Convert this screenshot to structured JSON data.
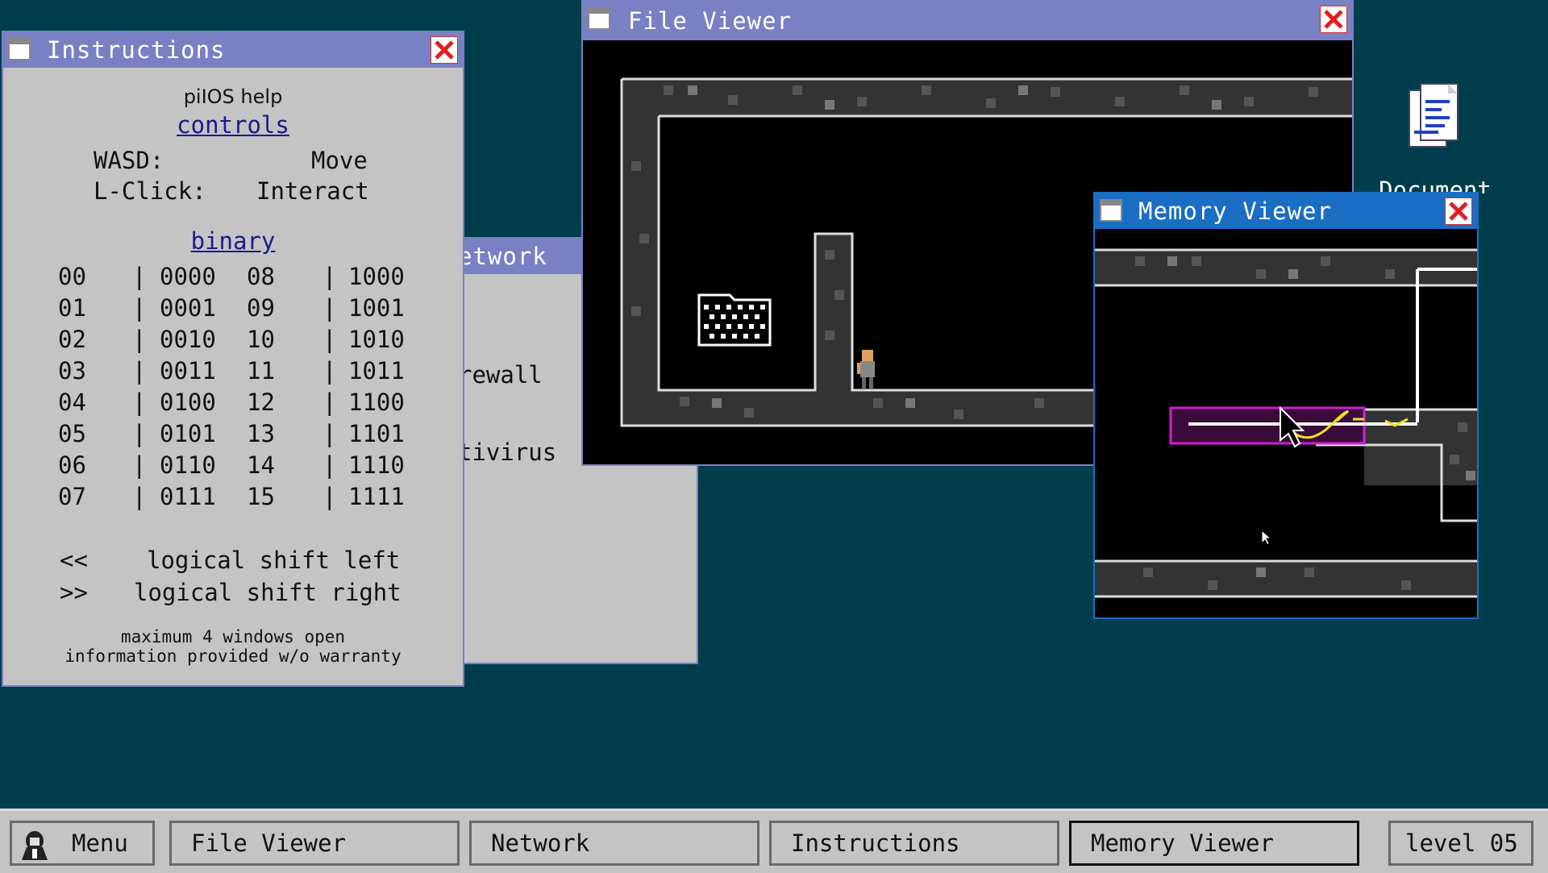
{
  "desktop": {
    "document_icon_label": "Document"
  },
  "windows": {
    "network": {
      "title": "Network",
      "items": [
        "Firewall",
        "Antivirus"
      ],
      "visible_items": [
        "rewall",
        "tivirus"
      ],
      "visible_title": "etwork"
    },
    "instructions": {
      "title": "Instructions",
      "heading": "piIOS help",
      "controls_header": "controls",
      "controls": [
        {
          "key": "WASD:",
          "action": "Move"
        },
        {
          "key": "L-Click:",
          "action": "Interact"
        }
      ],
      "binary_header": "binary",
      "binary_rows": [
        {
          "a": "00",
          "ab": "0000",
          "b": "08",
          "bb": "1000"
        },
        {
          "a": "01",
          "ab": "0001",
          "b": "09",
          "bb": "1001"
        },
        {
          "a": "02",
          "ab": "0010",
          "b": "10",
          "bb": "1010"
        },
        {
          "a": "03",
          "ab": "0011",
          "b": "11",
          "bb": "1011"
        },
        {
          "a": "04",
          "ab": "0100",
          "b": "12",
          "bb": "1100"
        },
        {
          "a": "05",
          "ab": "0101",
          "b": "13",
          "bb": "1101"
        },
        {
          "a": "06",
          "ab": "0110",
          "b": "14",
          "bb": "1110"
        },
        {
          "a": "07",
          "ab": "0111",
          "b": "15",
          "bb": "1111"
        }
      ],
      "shifts": [
        {
          "op": "<<",
          "desc": "logical shift left"
        },
        {
          "op": ">>",
          "desc": "logical shift right"
        }
      ],
      "footer_line1": "maximum 4 windows open",
      "footer_line2": "information provided w/o warranty"
    },
    "file_viewer": {
      "title": "File Viewer"
    },
    "memory_viewer": {
      "title": "Memory Viewer"
    }
  },
  "taskbar": {
    "menu_label": "Menu",
    "buttons": [
      "File Viewer",
      "Network",
      "Instructions",
      "Memory Viewer"
    ],
    "active_button": "Memory Viewer",
    "level_label": "level 05"
  },
  "colors": {
    "desktop": "#003d4c",
    "titlebar": "#7a80c4",
    "titlebar_active": "#1a6ec4",
    "window_bg": "#c4c4c4",
    "highlight_magenta": "#d020d0",
    "spark_yellow": "#f0e020"
  }
}
